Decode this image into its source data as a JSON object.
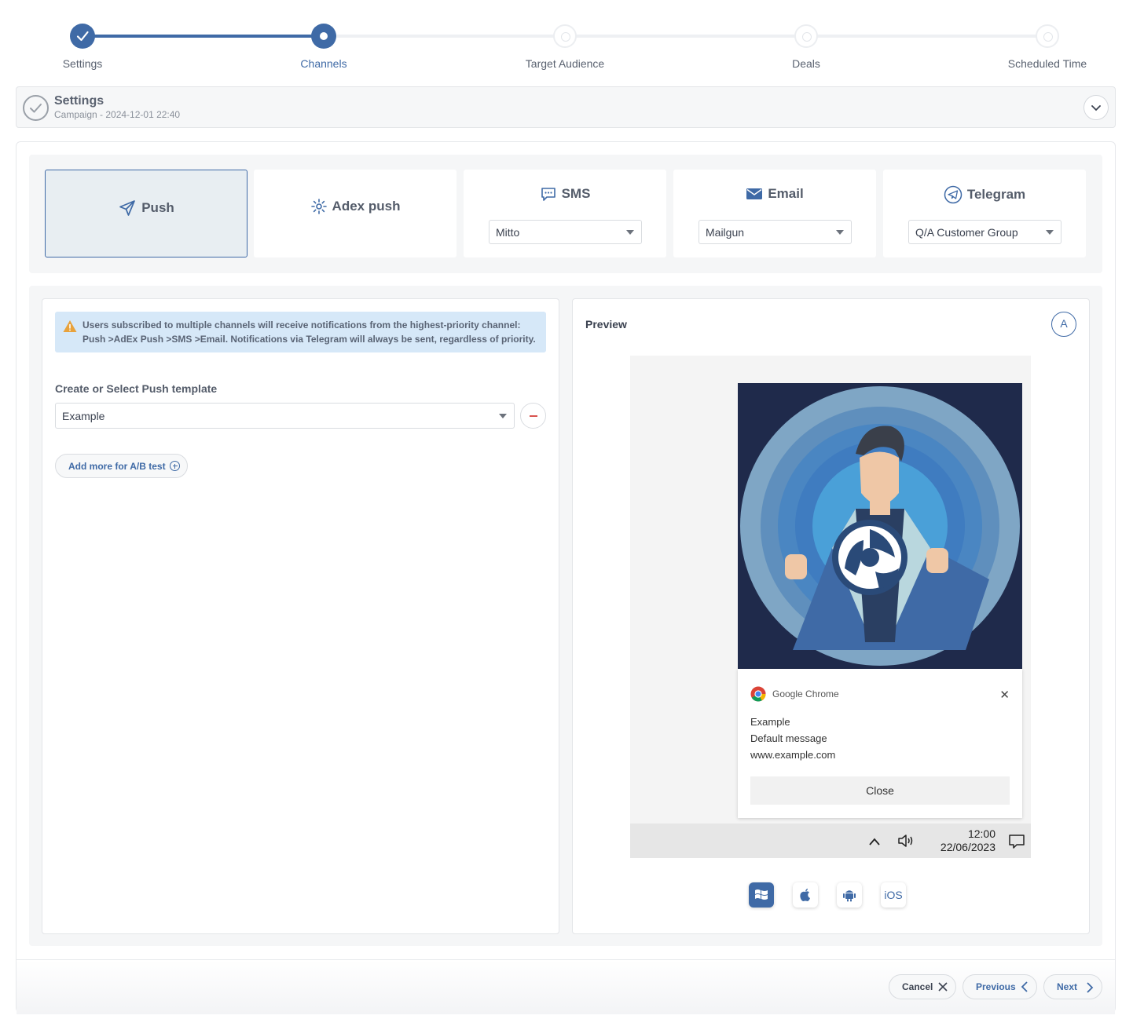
{
  "stepper": {
    "steps": [
      {
        "label": "Settings",
        "state": "done"
      },
      {
        "label": "Channels",
        "state": "current"
      },
      {
        "label": "Target Audience",
        "state": "todo"
      },
      {
        "label": "Deals",
        "state": "todo"
      },
      {
        "label": "Scheduled Time",
        "state": "todo"
      }
    ]
  },
  "settings_section": {
    "title": "Settings",
    "subtitle": "Campaign - 2024-12-01 22:40"
  },
  "channels": {
    "push": {
      "label": "Push",
      "icon": "send-icon"
    },
    "adex_push": {
      "label": "Adex push",
      "icon": "adex-icon"
    },
    "sms": {
      "label": "SMS",
      "icon": "chat-icon",
      "provider": "Mitto"
    },
    "email": {
      "label": "Email",
      "icon": "envelope-icon",
      "provider": "Mailgun"
    },
    "telegram": {
      "label": "Telegram",
      "icon": "telegram-icon",
      "provider": "Q/A Customer Group"
    }
  },
  "alert": {
    "text": "Users subscribed to multiple channels will receive notifications from the highest-priority channel: Push >AdEx Push >SMS >Email. Notifications via Telegram will always be sent, regardless of priority."
  },
  "template": {
    "label": "Create or Select Push template",
    "value": "Example",
    "add_ab_label": "Add more for A/B test"
  },
  "preview": {
    "title": "Preview",
    "variant": "A",
    "notification": {
      "browser": "Google Chrome",
      "title": "Example",
      "message": "Default message",
      "url": "www.example.com",
      "button": "Close"
    },
    "clock_time": "12:00",
    "clock_date": "22/06/2023",
    "platforms": [
      "Windows",
      "macOS",
      "Android",
      "iOS"
    ],
    "ios_label": "iOS"
  },
  "footer": {
    "cancel": "Cancel",
    "previous": "Previous",
    "next": "Next"
  },
  "colors": {
    "accent": "#3f6aa6",
    "alert_bg": "#d6e8f8",
    "warning": "#e8a23c"
  }
}
